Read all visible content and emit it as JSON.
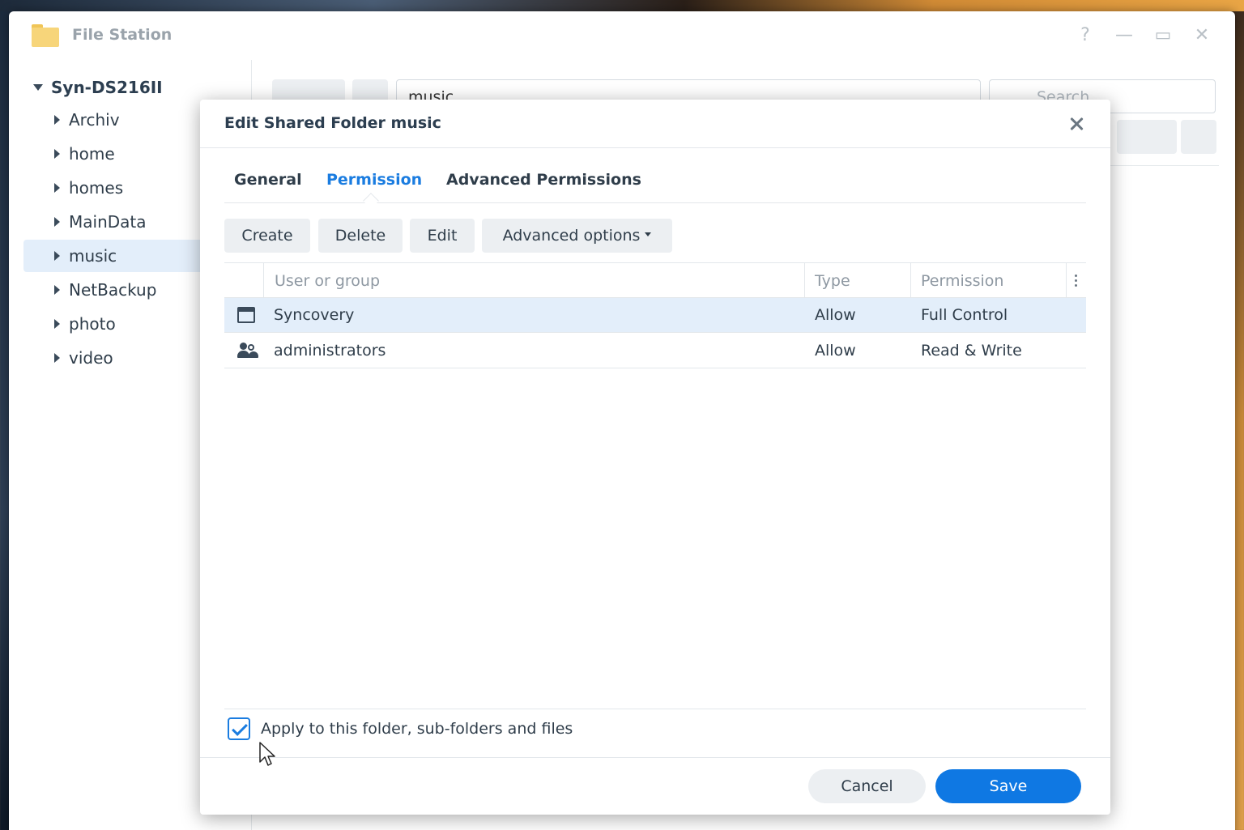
{
  "window": {
    "title": "File Station",
    "controls": {
      "help": "?",
      "minimize": "—",
      "maximize": "▭",
      "close": "✕"
    }
  },
  "sidebar": {
    "root": "Syn-DS216II",
    "items": [
      {
        "label": "Archiv",
        "selected": false
      },
      {
        "label": "home",
        "selected": false
      },
      {
        "label": "homes",
        "selected": false
      },
      {
        "label": "MainData",
        "selected": false
      },
      {
        "label": "music",
        "selected": true
      },
      {
        "label": "NetBackup",
        "selected": false
      },
      {
        "label": "photo",
        "selected": false
      },
      {
        "label": "video",
        "selected": false
      }
    ]
  },
  "toolbar": {
    "path": "music",
    "search_placeholder": "Search"
  },
  "dialog": {
    "title": "Edit Shared Folder music",
    "tabs": [
      {
        "label": "General",
        "active": false
      },
      {
        "label": "Permission",
        "active": true
      },
      {
        "label": "Advanced Permissions",
        "active": false
      }
    ],
    "actions": {
      "create": "Create",
      "delete": "Delete",
      "edit": "Edit",
      "advanced_options": "Advanced options"
    },
    "table": {
      "columns": [
        "User or group",
        "Type",
        "Permission"
      ],
      "rows": [
        {
          "icon": "user-icon",
          "name": "Syncovery",
          "type": "Allow",
          "permission": "Full Control",
          "selected": true
        },
        {
          "icon": "group-icon",
          "name": "administrators",
          "type": "Allow",
          "permission": "Read & Write",
          "selected": false
        }
      ]
    },
    "apply_checkbox": {
      "label": "Apply to this folder, sub-folders and files",
      "checked": true
    },
    "buttons": {
      "cancel": "Cancel",
      "save": "Save"
    }
  },
  "colors": {
    "accent": "#1a7ce0",
    "primary_button": "#0f78e3",
    "selection": "#e3eefa"
  }
}
